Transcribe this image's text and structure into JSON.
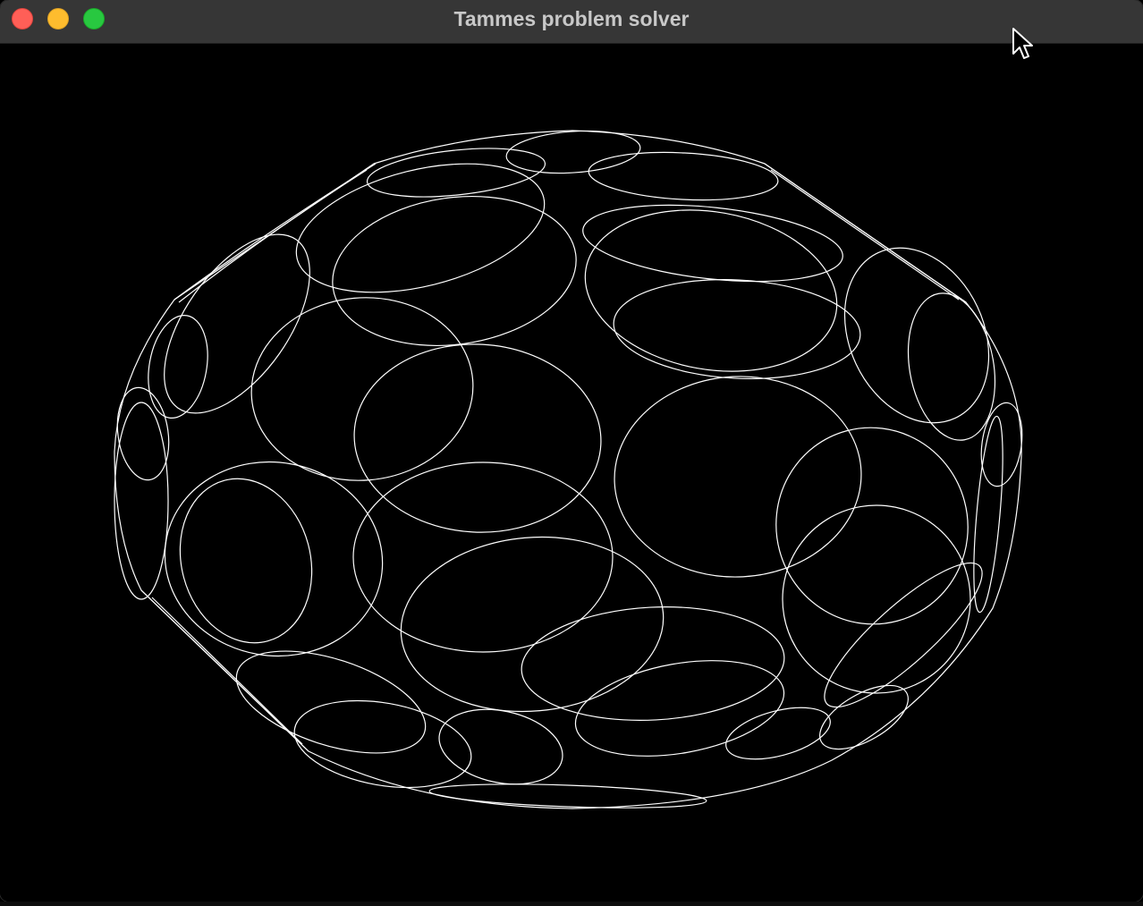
{
  "window": {
    "title": "Tammes problem solver"
  },
  "colors": {
    "titlebar": "#363636",
    "title_text": "#c8c8c8",
    "canvas_background": "#000000",
    "stroke": "#ffffff",
    "close": "#ff5f57",
    "minimize": "#febc2e",
    "maximize": "#28c840"
  },
  "icons": {
    "close": "close-traffic-light-icon",
    "minimize": "minimize-traffic-light-icon",
    "maximize": "maximize-traffic-light-icon",
    "cursor": "mouse-pointer-icon"
  }
}
